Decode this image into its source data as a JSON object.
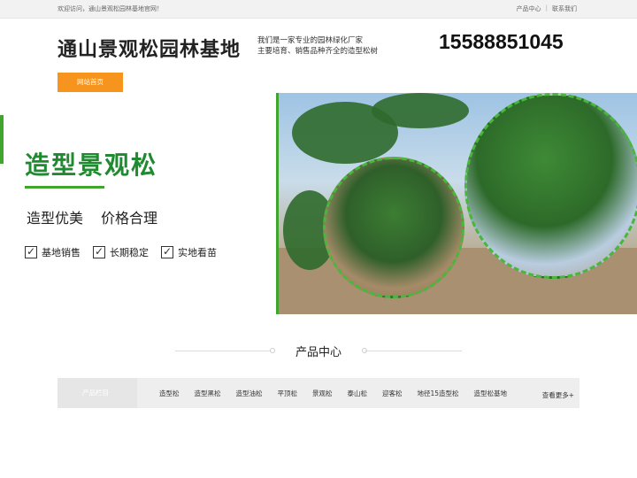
{
  "topbar": {
    "welcome": "欢迎访问，通山景观松园林基地官网！",
    "links": [
      "产品中心",
      "联系我们"
    ],
    "separator": "|"
  },
  "header": {
    "title": "通山景观松园林基地",
    "slogan_line1": "我们是一家专业的园林绿化厂家",
    "slogan_line2": "主要培育、销售品种齐全的造型松树",
    "phone": "15588851045"
  },
  "nav": {
    "home": "网站首页"
  },
  "banner": {
    "headline": "造型景观松",
    "sub1": "造型优美",
    "sub2": "价格合理",
    "checks": [
      "基地销售",
      "长期稳定",
      "实地看苗"
    ],
    "check_mark": "✓"
  },
  "products": {
    "title": "产品中心",
    "category_label": "产品栏目",
    "categories": [
      "造型松",
      "造型黑松",
      "造型油松",
      "平顶松",
      "景观松",
      "泰山松",
      "迎客松",
      "地径15造型松",
      "造型松基地"
    ],
    "more": "查看更多+"
  },
  "colors": {
    "accent": "#f7941d",
    "green": "#3fa52c"
  }
}
